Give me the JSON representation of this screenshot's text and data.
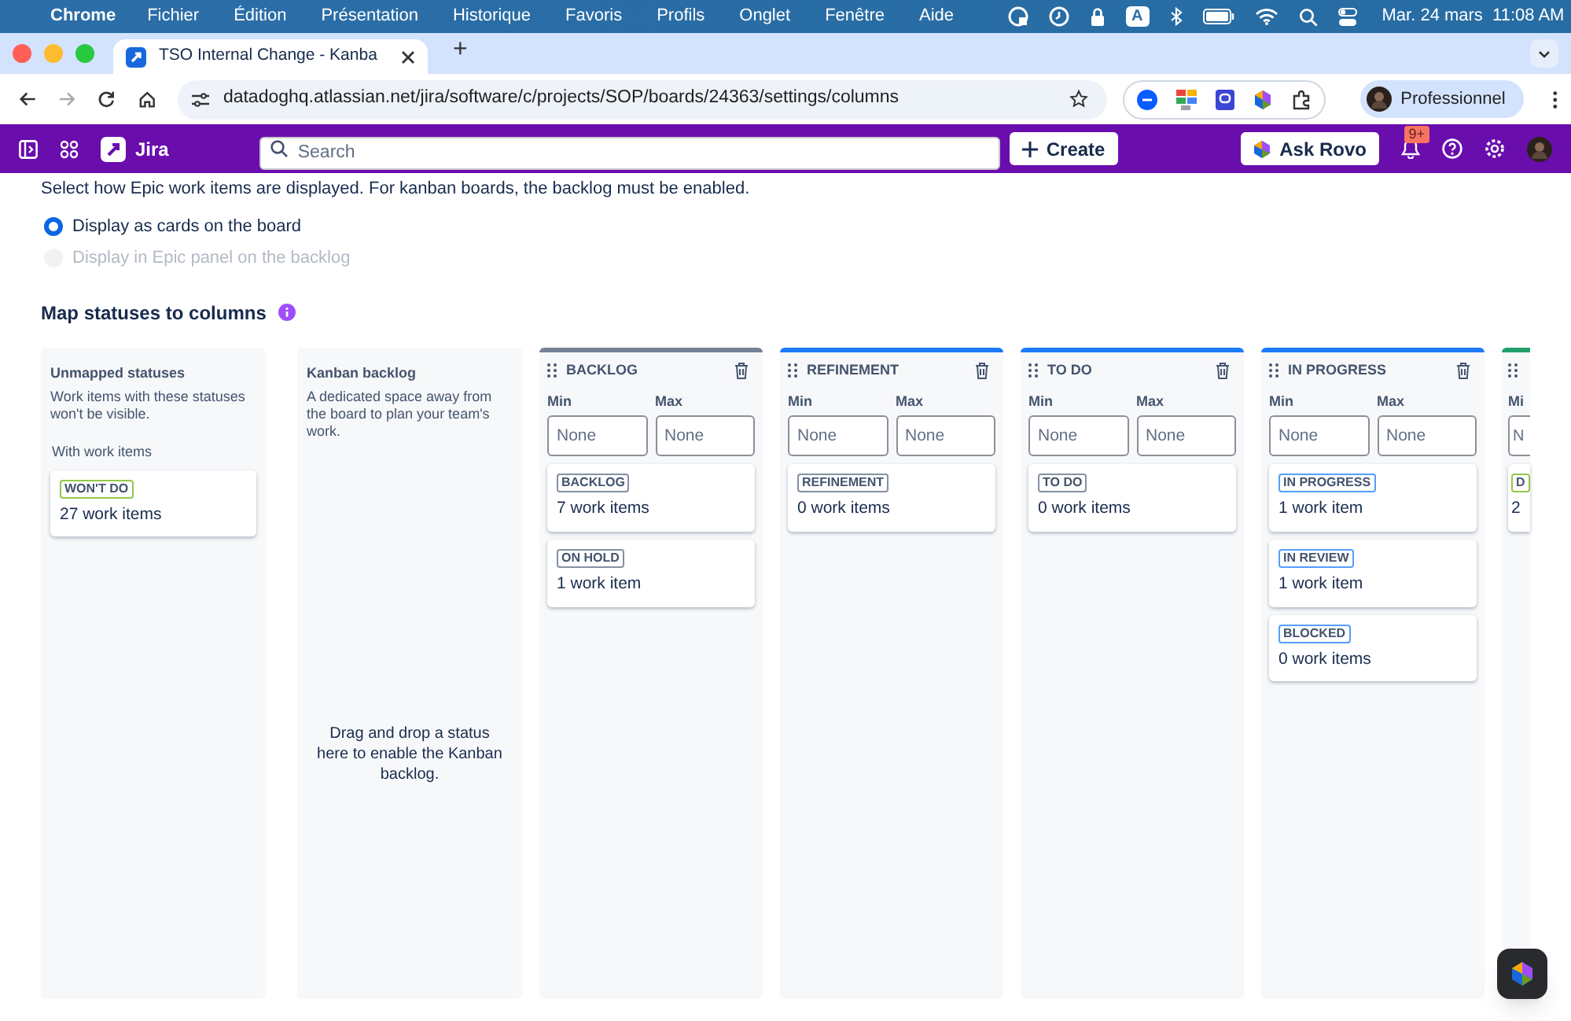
{
  "menu_bar": {
    "app": "Chrome",
    "items": [
      "Fichier",
      "Édition",
      "Présentation",
      "Historique",
      "Favoris",
      "Profils",
      "Onglet",
      "Fenêtre",
      "Aide"
    ],
    "input_source": "A",
    "clock": "Mar. 24 mars  11:08 AM"
  },
  "browser": {
    "tab_title": "TSO Internal Change - Kanba",
    "new_tab": "+",
    "url": "datadoghq.atlassian.net/jira/software/c/projects/SOP/boards/24363/settings/columns",
    "profile": "Professionnel"
  },
  "jira_bar": {
    "product": "Jira",
    "search_placeholder": "Search",
    "create": "Create",
    "ask_rovo": "Ask Rovo",
    "notifications": "9+"
  },
  "epic_settings": {
    "description": "Select how Epic work items are displayed. For kanban boards, the backlog must be enabled.",
    "options": [
      {
        "label": "Display as cards on the board",
        "selected": true,
        "disabled": false
      },
      {
        "label": "Display in Epic panel on the backlog",
        "selected": false,
        "disabled": true
      }
    ]
  },
  "section_title": "Map statuses to columns",
  "unmapped": {
    "title": "Unmapped statuses",
    "description": "Work items with these statuses won't be visible.",
    "group_label": "With work items",
    "statuses": [
      {
        "name": "WON'T DO",
        "count": "27 work items",
        "color": "#94c748"
      }
    ]
  },
  "kanban_backlog": {
    "title": "Kanban backlog",
    "description": "A dedicated space away from the board to plan your team's work.",
    "drop_hint": "Drag and drop a status here to enable the Kanban backlog."
  },
  "columns": [
    {
      "kind": "full",
      "name": "BACKLOG",
      "color": "#758195",
      "min_label": "Min",
      "max_label": "Max",
      "min_placeholder": "None",
      "max_placeholder": "None",
      "statuses": [
        {
          "name": "BACKLOG",
          "count": "7 work items",
          "color": "#8590a2"
        },
        {
          "name": "ON HOLD",
          "count": "1 work item",
          "color": "#8590a2"
        }
      ]
    },
    {
      "kind": "full",
      "name": "REFINEMENT",
      "color": "#1d7afc",
      "min_label": "Min",
      "max_label": "Max",
      "min_placeholder": "None",
      "max_placeholder": "None",
      "statuses": [
        {
          "name": "REFINEMENT",
          "count": "0 work items",
          "color": "#8590a2"
        }
      ]
    },
    {
      "kind": "full",
      "name": "TO DO",
      "color": "#1d7afc",
      "min_label": "Min",
      "max_label": "Max",
      "min_placeholder": "None",
      "max_placeholder": "None",
      "statuses": [
        {
          "name": "TO DO",
          "count": "0 work items",
          "color": "#8590a2"
        }
      ]
    },
    {
      "kind": "full",
      "name": "IN PROGRESS",
      "color": "#1d7afc",
      "min_label": "Min",
      "max_label": "Max",
      "min_placeholder": "None",
      "max_placeholder": "None",
      "statuses": [
        {
          "name": "IN PROGRESS",
          "count": "1 work item",
          "color": "#579dff"
        },
        {
          "name": "IN REVIEW",
          "count": "1 work item",
          "color": "#579dff"
        },
        {
          "name": "BLOCKED",
          "count": "0 work items",
          "color": "#579dff"
        }
      ]
    },
    {
      "kind": "partial",
      "color": "#22a06b",
      "min_label": "Mi",
      "min_placeholder": "N",
      "statuses": [
        {
          "name": "D",
          "count": "2",
          "color": "#94c748"
        }
      ]
    }
  ]
}
